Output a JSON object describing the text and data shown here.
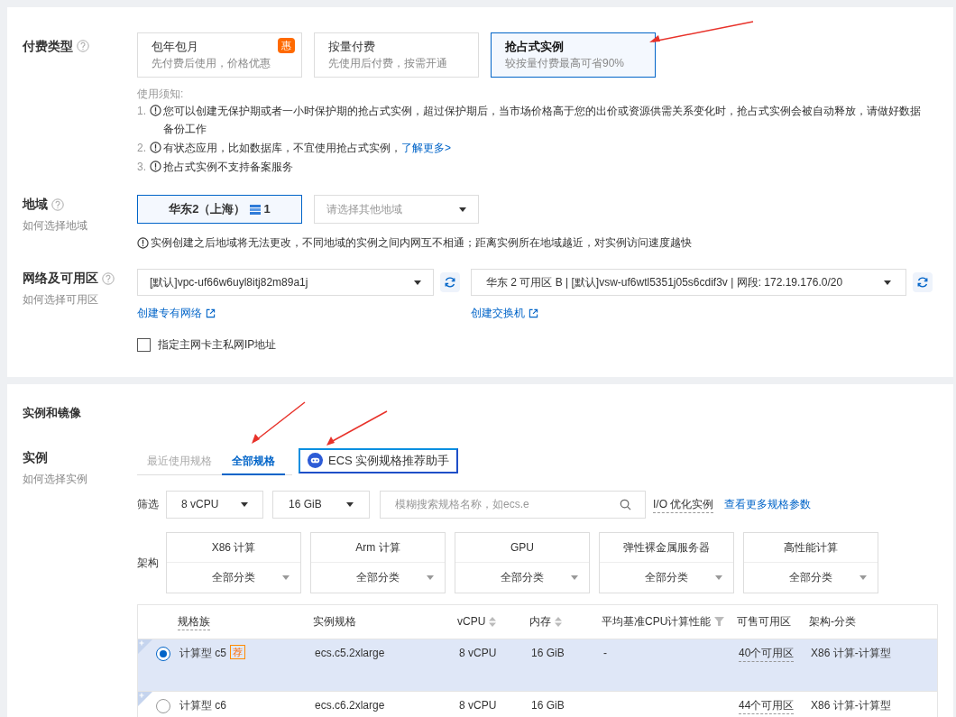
{
  "billing": {
    "label": "付费类型",
    "options": [
      {
        "title": "包年包月",
        "subtitle": "先付费后使用，价格优惠",
        "badge": "惠",
        "selected": false
      },
      {
        "title": "按量付费",
        "subtitle": "先使用后付费，按需开通",
        "selected": false
      },
      {
        "title": "抢占式实例",
        "subtitle": "较按量付费最高可省90%",
        "selected": true
      }
    ],
    "notice_title": "使用须知:",
    "notices": [
      {
        "index": "1.",
        "text": "您可以创建无保护期或者一小时保护期的抢占式实例，超过保护期后，当市场价格高于您的出价或资源供需关系变化时，抢占式实例会被自动释放，请做好数据备份工作"
      },
      {
        "index": "2.",
        "text": "有状态应用，比如数据库，不宜使用抢占式实例，",
        "link": "了解更多>"
      },
      {
        "index": "3.",
        "text": "抢占式实例不支持备案服务"
      }
    ]
  },
  "region": {
    "label": "地域",
    "help": "如何选择地域",
    "selected_region": "华东2（上海）",
    "count": "1",
    "other_placeholder": "请选择其他地域",
    "notice": "实例创建之后地域将无法更改，不同地域的实例之间内网互不相通；距离实例所在地域越近，对实例访问速度越快"
  },
  "network": {
    "label": "网络及可用区",
    "help": "如何选择可用区",
    "vpc": "[默认]vpc-uf66w6uyl8itj82m89a1j",
    "vswitch": "华东 2 可用区 B | [默认]vsw-uf6wtl5351j05s6cdif3v | 网段: 172.19.176.0/20",
    "vpc_link": "创建专有网络",
    "vswitch_link": "创建交换机",
    "private_ip": {
      "label": "指定主网卡主私网IP地址",
      "checked": false
    }
  },
  "instance_section": {
    "title": "实例和镜像",
    "label": "实例",
    "help": "如何选择实例",
    "tabs": [
      {
        "label": "最近使用规格",
        "selected": false
      },
      {
        "label": "全部规格",
        "selected": true
      }
    ],
    "assistant_button": "ECS 实例规格推荐助手",
    "filter_label": "筛选",
    "vcpu_filter": "8 vCPU",
    "memory_filter": "16 GiB",
    "search_placeholder": "模糊搜索规格名称，如ecs.e",
    "io_option": "I/O 优化实例",
    "more_link": "查看更多规格参数",
    "arch_label": "架构",
    "architectures": [
      {
        "name": "X86 计算",
        "category": "全部分类"
      },
      {
        "name": "Arm 计算",
        "category": "全部分类"
      },
      {
        "name": "GPU",
        "category": "全部分类"
      },
      {
        "name": "弹性裸金属服务器",
        "category": "全部分类"
      },
      {
        "name": "高性能计算",
        "category": "全部分类"
      }
    ],
    "table": {
      "columns": [
        {
          "label": "规格族",
          "kind": "dashed"
        },
        {
          "label": "实例规格",
          "kind": "plain"
        },
        {
          "label": "vCPU",
          "kind": "sort"
        },
        {
          "label": "内存",
          "kind": "sort"
        },
        {
          "label": "平均基准CPU计算性能",
          "kind": "filter"
        },
        {
          "label": "可售可用区",
          "kind": "plain"
        },
        {
          "label": "架构-分类",
          "kind": "plain"
        }
      ],
      "rows": [
        {
          "selected": true,
          "family": "计算型 c5",
          "tag": "荐",
          "spec": "ecs.c5.2xlarge",
          "vcpu": "8 vCPU",
          "memory": "16 GiB",
          "performance": "-",
          "zones": "40个可用区",
          "arch": "X86 计算-计算型"
        },
        {
          "selected": false,
          "family": "计算型 c6",
          "spec": "ecs.c6.2xlarge",
          "vcpu": "8 vCPU",
          "memory": "16 GiB",
          "zones": "44个可用区",
          "arch": "X86 计算-计算型"
        }
      ]
    }
  }
}
